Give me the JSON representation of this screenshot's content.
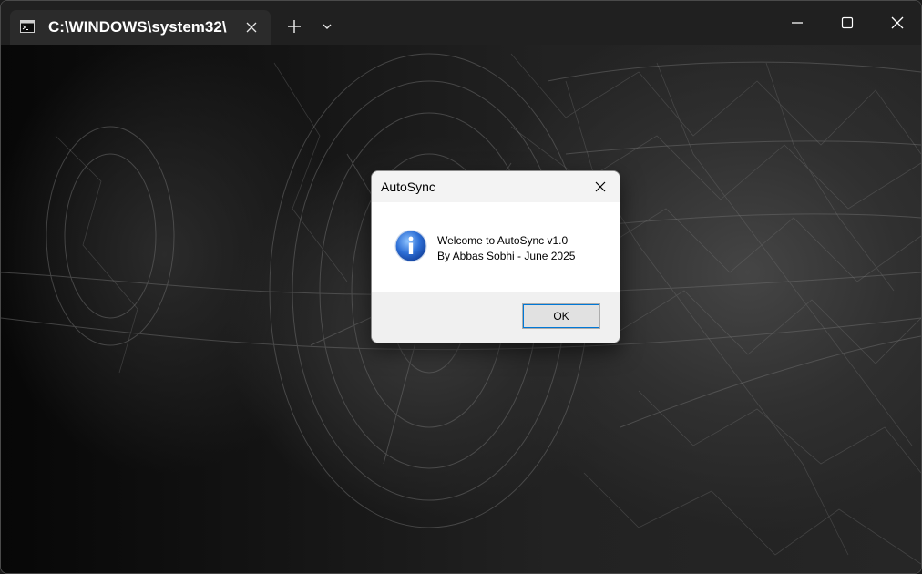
{
  "terminal": {
    "tab_title": "C:\\WINDOWS\\system32\\",
    "tab_icon": "terminal-icon",
    "new_tab_icon": "plus-icon",
    "dropdown_icon": "chevron-down-icon",
    "window_controls": [
      "minimize-icon",
      "maximize-icon",
      "close-icon"
    ]
  },
  "background": {
    "description_icon": "wireframe-car-wallpaper"
  },
  "dialog": {
    "title": "AutoSync",
    "icon": "info-icon",
    "message_line1": "Welcome to AutoSync v1.0",
    "message_line2": "By Abbas Sobhi - June 2025",
    "ok_label": "OK",
    "accent_color": "#0078d7"
  }
}
